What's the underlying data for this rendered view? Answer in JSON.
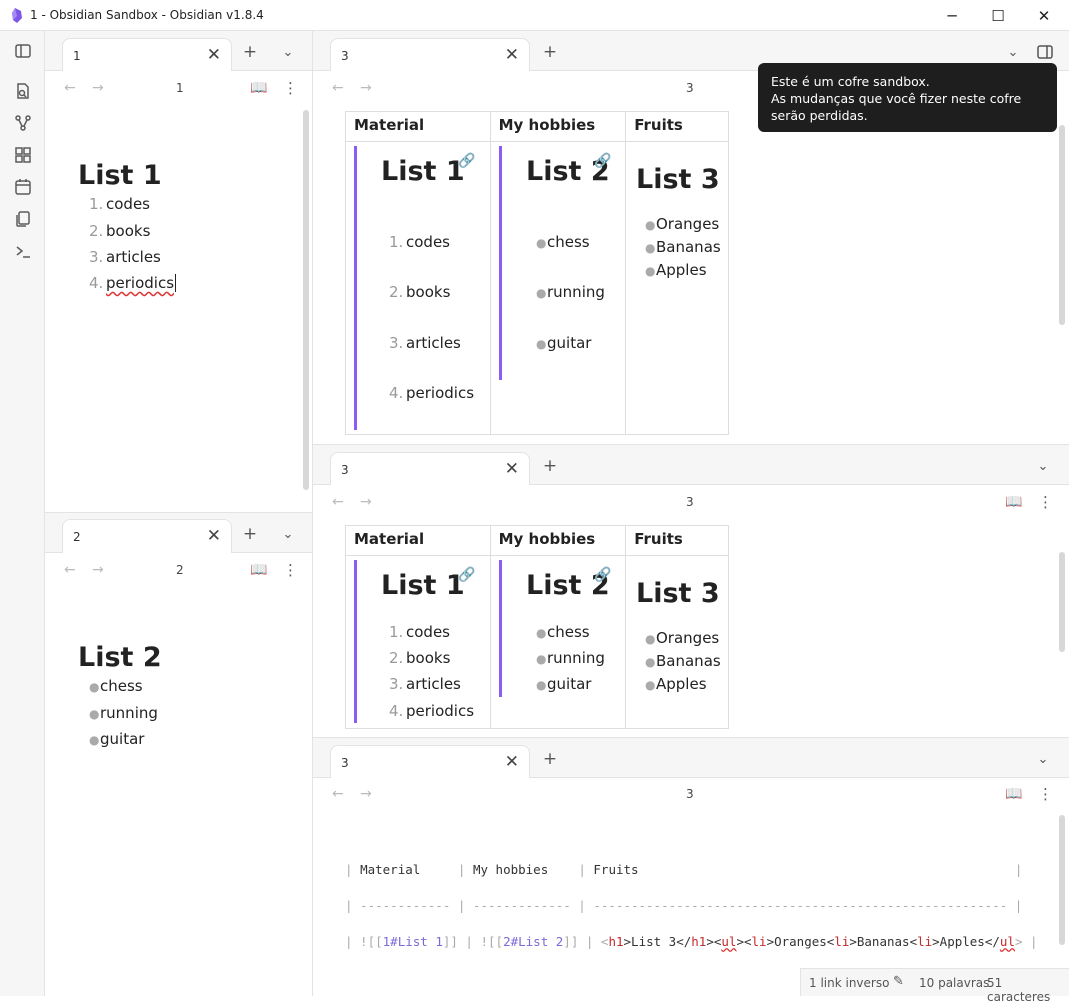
{
  "window": {
    "title": "1 - Obsidian Sandbox - Obsidian v1.8.4",
    "minimize": "─",
    "maximize": "☐",
    "close": "✕"
  },
  "ribbon": [
    "sidebar-toggle-icon",
    "open-quick-switcher-icon",
    "graph-view-icon",
    "canvas-icon",
    "daily-note-icon",
    "templates-icon",
    "command-palette-icon"
  ],
  "left_top": {
    "tab_label": "1",
    "view_title": "1",
    "note": {
      "heading": "List 1",
      "items": [
        {
          "n": "1.",
          "t": "codes"
        },
        {
          "n": "2.",
          "t": "books"
        },
        {
          "n": "3.",
          "t": "articles"
        },
        {
          "n": "4.",
          "t": "periodics"
        }
      ]
    }
  },
  "left_bottom": {
    "tab_label": "2",
    "view_title": "2",
    "note": {
      "heading": "List 2",
      "items": [
        "chess",
        "running",
        "guitar"
      ]
    }
  },
  "tooltip": {
    "line1": "Este é um cofre sandbox.",
    "line2": "As mudanças que você fizer neste cofre serão perdidas."
  },
  "pane_top": {
    "tab_label": "3",
    "view_title": "3"
  },
  "pane_mid": {
    "tab_label": "3",
    "view_title": "3"
  },
  "pane_bot": {
    "tab_label": "3",
    "view_title": "3"
  },
  "table": {
    "headers": [
      "Material",
      "My hobbies",
      "Fruits"
    ],
    "list1": {
      "heading": "List 1",
      "items": [
        {
          "n": "1.",
          "t": "codes"
        },
        {
          "n": "2.",
          "t": "books"
        },
        {
          "n": "3.",
          "t": "articles"
        },
        {
          "n": "4.",
          "t": "periodics"
        }
      ]
    },
    "list2": {
      "heading": "List 2",
      "items": [
        "chess",
        "running",
        "guitar"
      ]
    },
    "list3": {
      "heading": "List 3",
      "items": [
        "Oranges",
        "Bananas",
        "Apples"
      ]
    }
  },
  "source": {
    "row1": [
      "| ",
      "Material",
      "     | ",
      "My hobbies",
      "    | ",
      "Fruits",
      "                                                  |"
    ],
    "row2": "| ------------ | ------------- | ------------------------------------------------------- |",
    "row3": {
      "a": "| ![[",
      "b": "1#List 1",
      "c": "]] | ![[",
      "d": "2#List 2",
      "e": "]] | <",
      "f": "h1",
      "g": ">List 3</",
      "h": "h1",
      "i": "><",
      "j": "ul",
      "k": "><",
      "l": "li",
      "m": ">Oranges<",
      "n": "li",
      "o": ">Bananas<",
      "p": "li",
      "q": ">Apples</",
      "r": "ul",
      "s": "> |"
    }
  },
  "status": {
    "backlinks": "1 link inverso",
    "words": "10 palavras",
    "chars": "51 caracteres"
  }
}
